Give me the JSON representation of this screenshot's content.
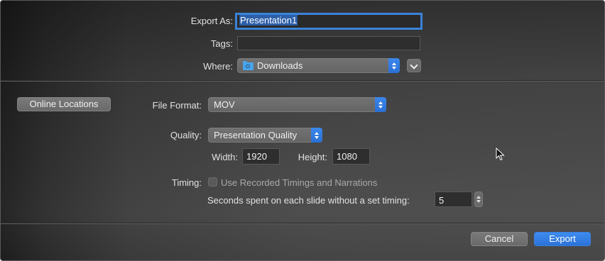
{
  "export_as": {
    "label": "Export As:",
    "value": "Presentation1"
  },
  "tags": {
    "label": "Tags:",
    "value": ""
  },
  "where": {
    "label": "Where:",
    "value": "Downloads",
    "icon": "folder-icon"
  },
  "online_locations_label": "Online Locations",
  "file_format": {
    "label": "File Format:",
    "value": "MOV"
  },
  "quality": {
    "label": "Quality:",
    "value": "Presentation Quality"
  },
  "width": {
    "label": "Width:",
    "value": "1920"
  },
  "height": {
    "label": "Height:",
    "value": "1080"
  },
  "timing": {
    "label": "Timing:",
    "checkbox_label": "Use Recorded Timings and Narrations",
    "checked": false,
    "seconds_label": "Seconds spent on each slide without a set timing:",
    "seconds_value": "5"
  },
  "buttons": {
    "cancel": "Cancel",
    "export": "Export"
  },
  "colors": {
    "accent": "#3a82d8",
    "background": "#464646"
  }
}
